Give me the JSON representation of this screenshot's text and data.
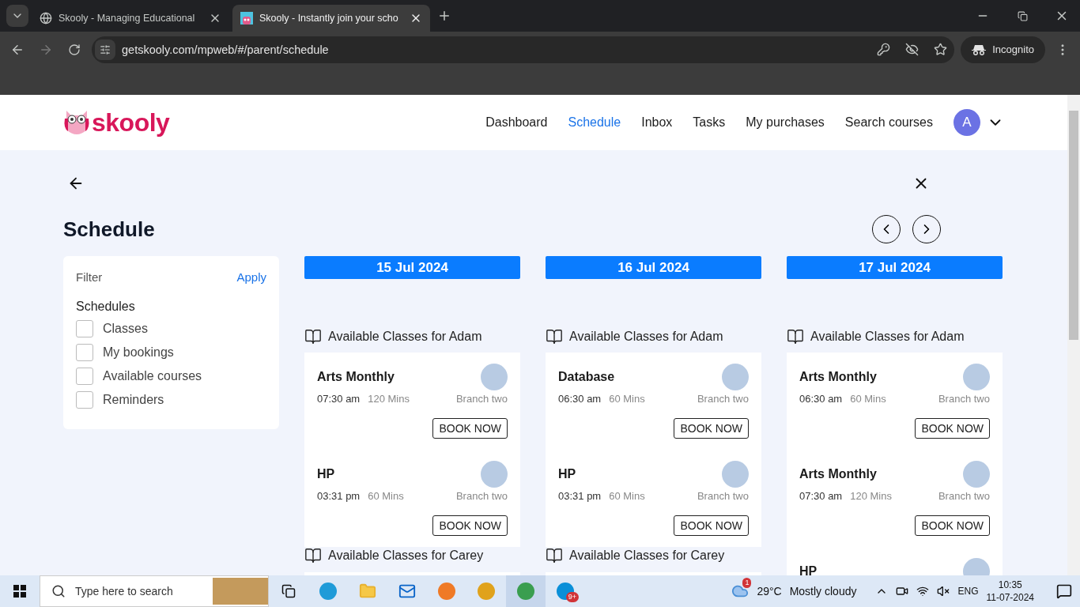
{
  "browser": {
    "tabs": [
      {
        "title": "Skooly - Managing Educational",
        "selected": false
      },
      {
        "title": "Skooly - Instantly join your scho",
        "selected": true
      }
    ],
    "url": "getskooly.com/mpweb/#/parent/schedule",
    "profile": "Incognito"
  },
  "header": {
    "logo": "skooly",
    "nav": [
      {
        "label": "Dashboard",
        "selected": false
      },
      {
        "label": "Schedule",
        "selected": true
      },
      {
        "label": "Inbox",
        "selected": false
      },
      {
        "label": "Tasks",
        "selected": false
      },
      {
        "label": "My purchases",
        "selected": false
      },
      {
        "label": "Search courses",
        "selected": false
      }
    ],
    "avatar": "A"
  },
  "page": {
    "title": "Schedule"
  },
  "filter": {
    "title": "Filter",
    "apply": "Apply",
    "group": "Schedules",
    "options": [
      {
        "label": "Classes",
        "checked": false
      },
      {
        "label": "My bookings",
        "checked": false
      },
      {
        "label": "Available courses",
        "checked": false
      },
      {
        "label": "Reminders",
        "checked": false
      }
    ]
  },
  "days": [
    {
      "date": "15 Jul 2024",
      "sections": [
        {
          "title": "Available Classes for Adam",
          "classes": [
            {
              "name": "Arts Monthly",
              "time": "07:30 am",
              "duration": "120 Mins",
              "branch": "Branch two",
              "action": "BOOK NOW"
            },
            {
              "name": "HP",
              "time": "03:31 pm",
              "duration": "60 Mins",
              "branch": "Branch two",
              "action": "BOOK NOW"
            }
          ]
        },
        {
          "title": "Available Classes for Carey"
        }
      ]
    },
    {
      "date": "16 Jul 2024",
      "sections": [
        {
          "title": "Available Classes for Adam",
          "classes": [
            {
              "name": "Database",
              "time": "06:30 am",
              "duration": "60 Mins",
              "branch": "Branch two",
              "action": "BOOK NOW"
            },
            {
              "name": "HP",
              "time": "03:31 pm",
              "duration": "60 Mins",
              "branch": "Branch two",
              "action": "BOOK NOW"
            }
          ]
        },
        {
          "title": "Available Classes for Carey"
        }
      ]
    },
    {
      "date": "17 Jul 2024",
      "sections": [
        {
          "title": "Available Classes for Adam",
          "classes": [
            {
              "name": "Arts Monthly",
              "time": "06:30 am",
              "duration": "60 Mins",
              "branch": "Branch two",
              "action": "BOOK NOW"
            },
            {
              "name": "Arts Monthly",
              "time": "07:30 am",
              "duration": "120 Mins",
              "branch": "Branch two",
              "action": "BOOK NOW"
            },
            {
              "name": "HP"
            }
          ]
        }
      ]
    }
  ],
  "taskbar": {
    "search_placeholder": "Type here to search",
    "skype_badge": "9+",
    "weather_badge": "1",
    "temperature": "29°C",
    "weather": "Mostly cloudy",
    "language": "ENG",
    "time": "10:35",
    "date": "11-07-2024"
  }
}
